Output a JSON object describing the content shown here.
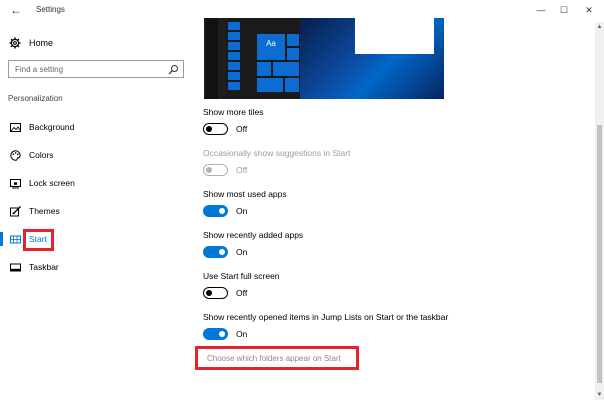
{
  "window": {
    "title": "Settings",
    "back_glyph": "←",
    "minimize_glyph": "—",
    "maximize_glyph": "☐",
    "close_glyph": "✕"
  },
  "sidebar": {
    "home_label": "Home",
    "search_placeholder": "Find a setting",
    "section_label": "Personalization",
    "items": [
      {
        "label": "Background",
        "icon": "image-icon"
      },
      {
        "label": "Colors",
        "icon": "palette-icon"
      },
      {
        "label": "Lock screen",
        "icon": "lock-screen-icon"
      },
      {
        "label": "Themes",
        "icon": "brush-icon"
      },
      {
        "label": "Start",
        "icon": "start-icon",
        "selected": true
      },
      {
        "label": "Taskbar",
        "icon": "taskbar-icon"
      }
    ]
  },
  "preview": {
    "tile_text": "Aa"
  },
  "settings": [
    {
      "label": "Show more tiles",
      "state": "Off",
      "enabled": true
    },
    {
      "label": "Occasionally show suggestions in Start",
      "state": "Off",
      "enabled": false
    },
    {
      "label": "Show most used apps",
      "state": "On",
      "enabled": true
    },
    {
      "label": "Show recently added apps",
      "state": "On",
      "enabled": true
    },
    {
      "label": "Use Start full screen",
      "state": "Off",
      "enabled": true
    },
    {
      "label": "Show recently opened items in Jump Lists on Start or the taskbar",
      "state": "On",
      "enabled": true
    }
  ],
  "link": {
    "label": "Choose which folders appear on Start"
  },
  "colors": {
    "accent": "#0078d7",
    "highlight_box": "#e3242b"
  }
}
